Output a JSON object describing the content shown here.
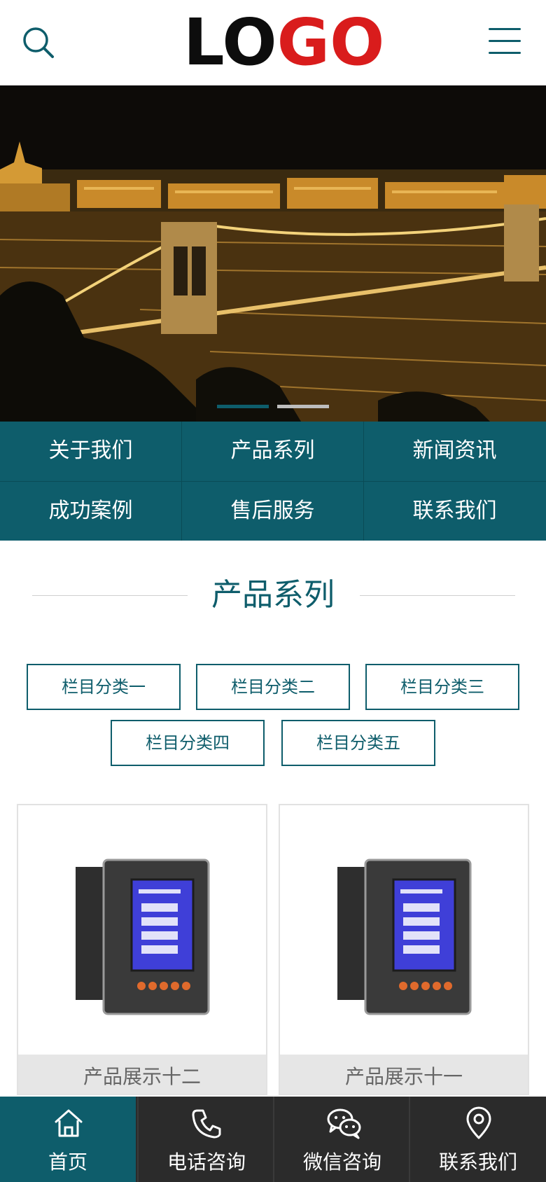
{
  "header": {
    "logo_part1": "LO",
    "logo_part2": "GO",
    "logo_colors": {
      "dark": "#0d0d0d",
      "red": "#d91c1c"
    },
    "search_icon": "search-icon",
    "menu_icon": "hamburger-menu-icon"
  },
  "banner": {
    "slides_count": 2,
    "active_slide": 1
  },
  "nav": {
    "items": [
      {
        "label": "关于我们"
      },
      {
        "label": "产品系列"
      },
      {
        "label": "新闻资讯"
      },
      {
        "label": "成功案例"
      },
      {
        "label": "售后服务"
      },
      {
        "label": "联系我们"
      }
    ]
  },
  "section": {
    "title": "产品系列",
    "categories": [
      "栏目分类一",
      "栏目分类二",
      "栏目分类三",
      "栏目分类四",
      "栏目分类五"
    ]
  },
  "products": [
    {
      "name": "产品展示十二"
    },
    {
      "name": "产品展示十一"
    }
  ],
  "bottom_bar": {
    "tabs": [
      {
        "label": "首页",
        "icon": "home-icon"
      },
      {
        "label": "电话咨询",
        "icon": "phone-icon"
      },
      {
        "label": "微信咨询",
        "icon": "wechat-icon"
      },
      {
        "label": "联系我们",
        "icon": "location-pin-icon"
      }
    ]
  },
  "colors": {
    "brand": "#0e5d6b",
    "bottom_bar_bg": "#2b2b2b",
    "caption_bg": "#e6e6e6"
  }
}
